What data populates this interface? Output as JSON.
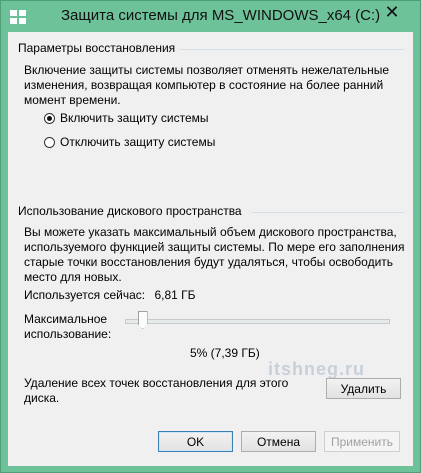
{
  "window": {
    "title": "Защита системы для MS_WINDOWS_x64 (C:)",
    "close_glyph": "✕",
    "accent_color": "#6ec29a"
  },
  "restore_settings": {
    "header": "Параметры восстановления",
    "description_lines": [
      "Включение защиты системы позволяет отменять нежелательные",
      "изменения, возвращая компьютер в состояние на более ранний",
      "момент времени."
    ],
    "options": [
      {
        "label": "Включить защиту системы",
        "selected": true
      },
      {
        "label": "Отключить защиту системы",
        "selected": false
      }
    ]
  },
  "disk_usage": {
    "header": "Использование дискового пространства",
    "description_lines": [
      "Вы можете указать максимальный объем дискового пространства,",
      "используемого функцией защиты системы. По мере его заполнения",
      "старые точки восстановления будут удаляться, чтобы освободить",
      "место для новых."
    ],
    "current_usage_label": "Используется сейчас:",
    "current_usage_value": "6,81 ГБ",
    "max_usage_label_lines": [
      "Максимальное",
      "использование:"
    ],
    "slider_percent": 5,
    "slider_value_text": "5% (7,39 ГБ)",
    "delete_text_lines": [
      "Удаление всех точек восстановления для этого",
      "диска."
    ],
    "delete_button": "Удалить"
  },
  "watermark_text": "itshneg.ru",
  "buttons": {
    "ok": "OK",
    "cancel": "Отмена",
    "apply": "Применить"
  }
}
